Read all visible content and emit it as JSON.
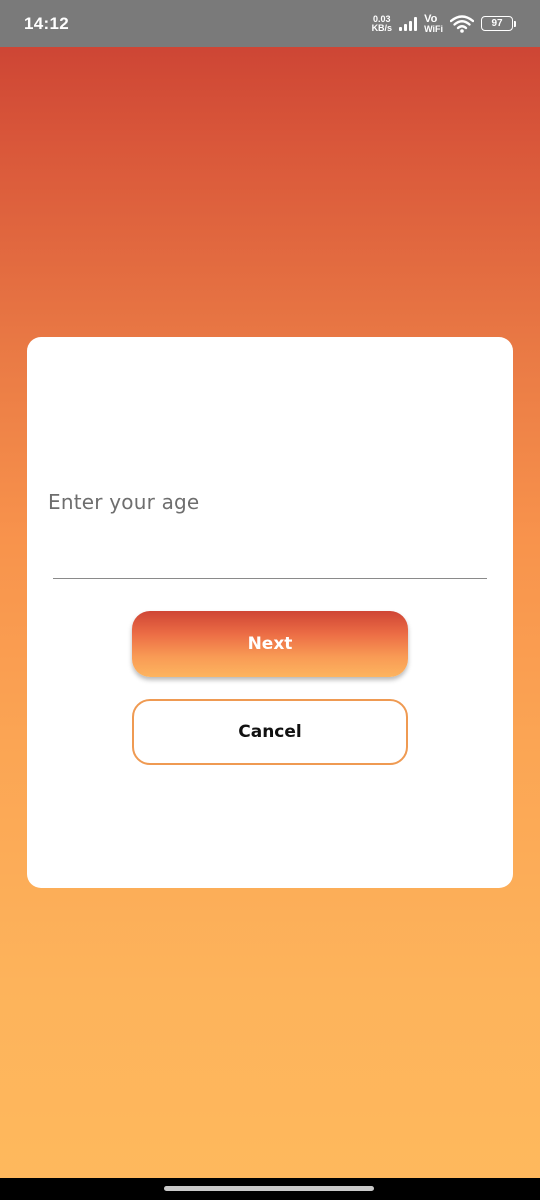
{
  "status_bar": {
    "time": "14:12",
    "net_speed_value": "0.03",
    "net_speed_unit": "KB/s",
    "vo_label": "Vo",
    "wifi_label": "WiFi",
    "battery_level": "97"
  },
  "dialog": {
    "age_placeholder": "Enter your age",
    "age_value": "",
    "next_label": "Next",
    "cancel_label": "Cancel"
  },
  "colors": {
    "gradient_top": "#c83d32",
    "gradient_bottom": "#feb95d",
    "cancel_border": "#ef9a52"
  }
}
